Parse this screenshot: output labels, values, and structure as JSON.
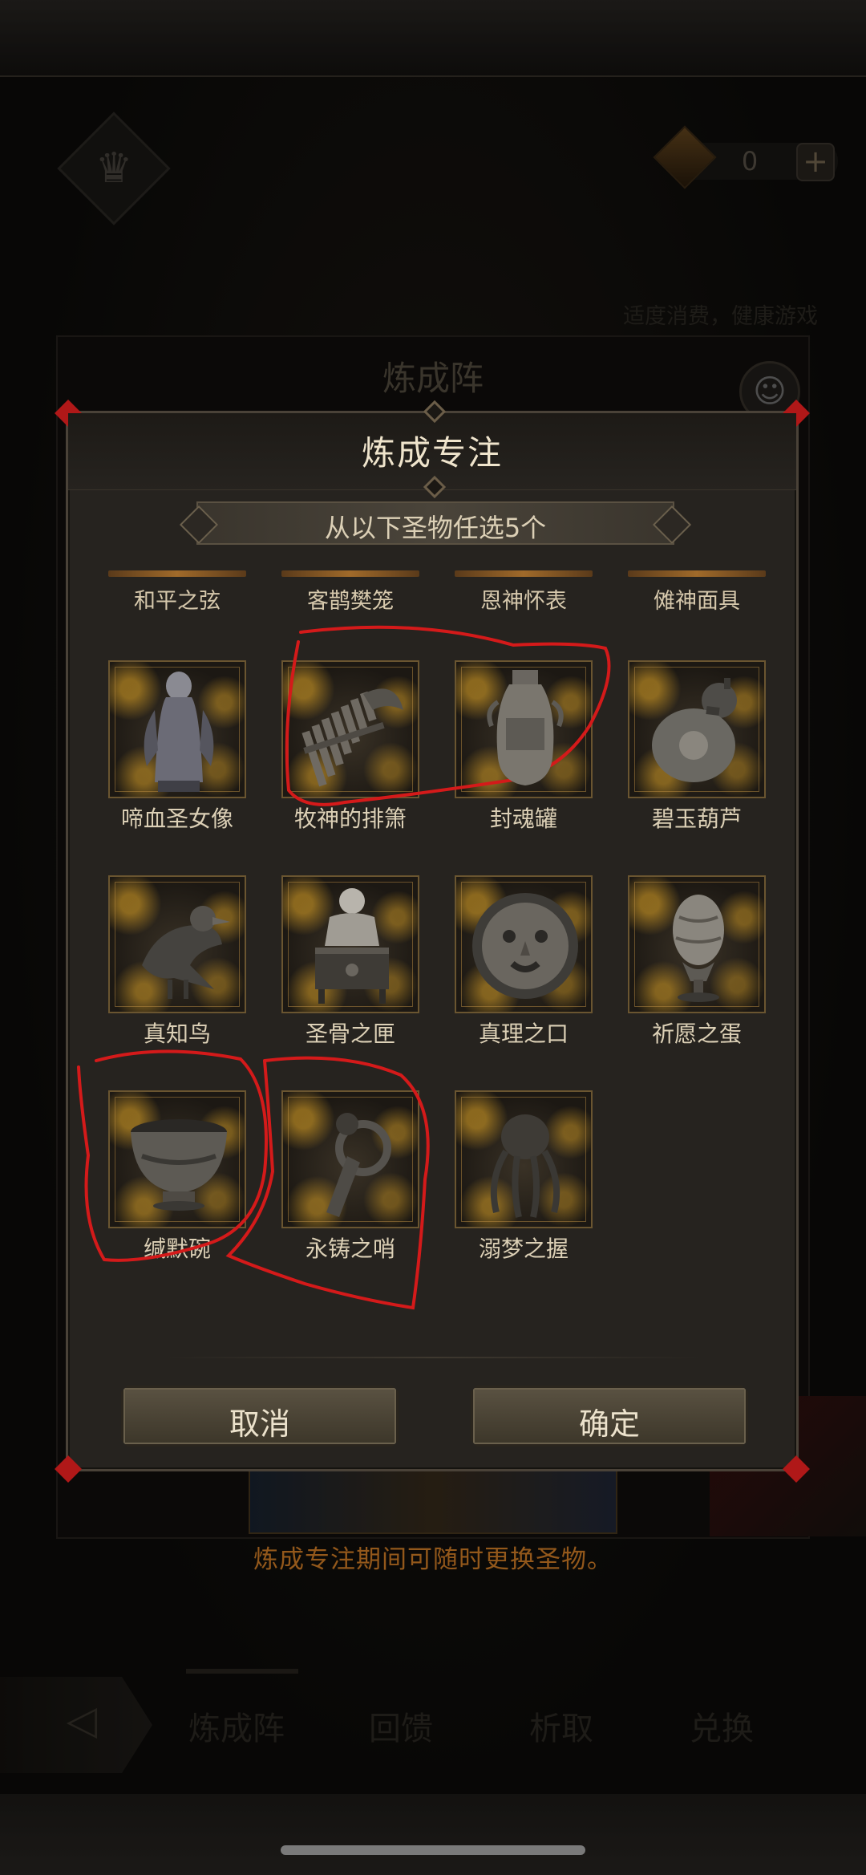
{
  "background": {
    "currency_value": "0",
    "currency_add": "+",
    "notice": "适度消费，健康游戏",
    "panel_title": "炼成阵",
    "tip": "炼成专注期间可随时更换圣物。",
    "nav_tabs": [
      "炼成阵",
      "回馈",
      "析取",
      "兑换"
    ]
  },
  "modal": {
    "title": "炼成专注",
    "subtitle": "从以下圣物任选5个",
    "top_row_labels": [
      "和平之弦",
      "客鹊樊笼",
      "恩神怀表",
      "傩神面具"
    ],
    "items": [
      {
        "label": "啼血圣女像",
        "icon": "statue-icon"
      },
      {
        "label": "牧神的排箫",
        "icon": "panpipe-icon"
      },
      {
        "label": "封魂罐",
        "icon": "urn-icon"
      },
      {
        "label": "碧玉葫芦",
        "icon": "gourd-icon"
      },
      {
        "label": "真知鸟",
        "icon": "bird-icon"
      },
      {
        "label": "圣骨之匣",
        "icon": "reliquary-icon"
      },
      {
        "label": "真理之口",
        "icon": "mask-icon"
      },
      {
        "label": "祈愿之蛋",
        "icon": "egg-icon"
      },
      {
        "label": "缄默碗",
        "icon": "bowl-icon"
      },
      {
        "label": "永铸之哨",
        "icon": "whistle-icon"
      },
      {
        "label": "溺梦之握",
        "icon": "tentacle-icon"
      }
    ],
    "cancel_label": "取消",
    "confirm_label": "确定"
  },
  "colors": {
    "accent_gold": "#c9962e",
    "tip_orange": "#e2882a",
    "annotation_red": "#d41a1a"
  }
}
